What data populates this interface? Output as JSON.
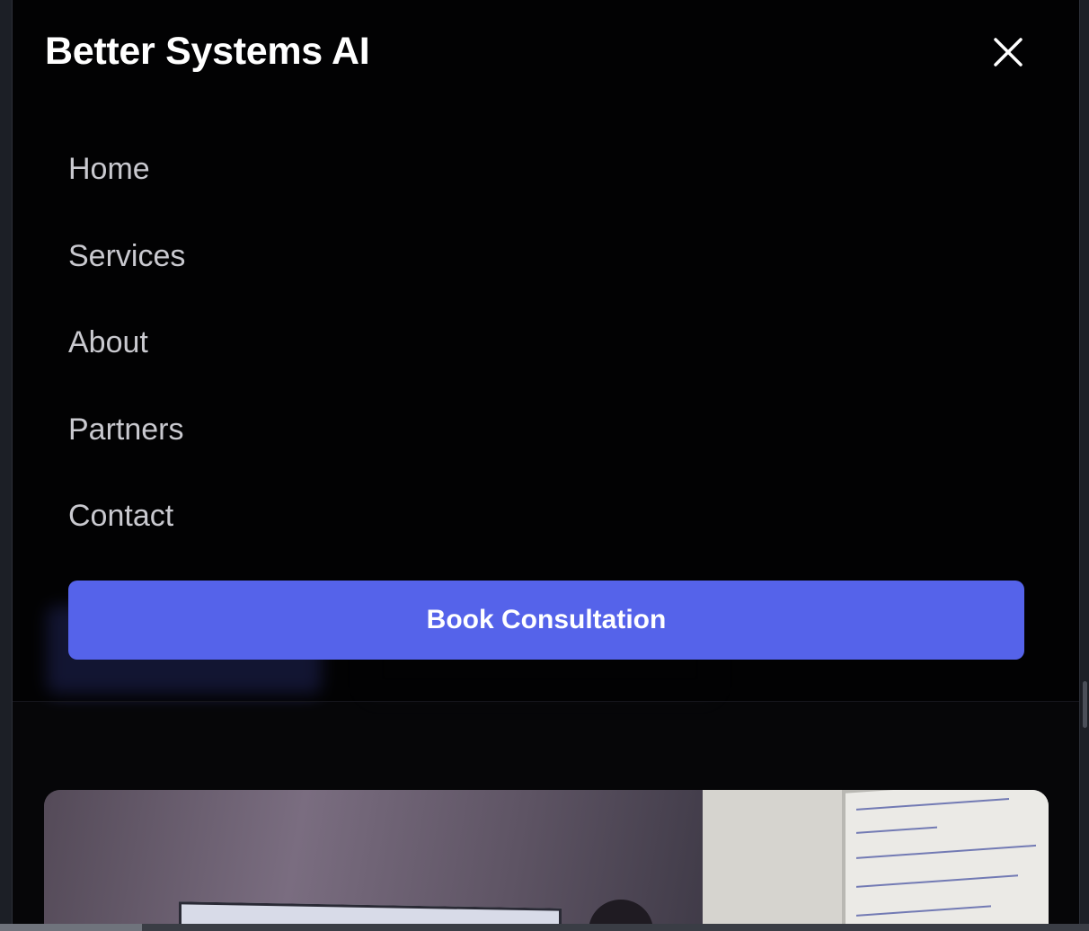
{
  "brand": {
    "name": "Better Systems AI"
  },
  "menu": {
    "close_icon": "close-icon",
    "items": [
      {
        "label": "Home"
      },
      {
        "label": "Services"
      },
      {
        "label": "About"
      },
      {
        "label": "Partners"
      },
      {
        "label": "Contact"
      }
    ],
    "cta_label": "Book Consultation"
  },
  "colors": {
    "accent": "#5563ea",
    "background": "#060608",
    "menu_text": "#c9c9cf",
    "heading": "#ffffff"
  },
  "page_scroll": {
    "horizontal_fraction": 0.13
  }
}
